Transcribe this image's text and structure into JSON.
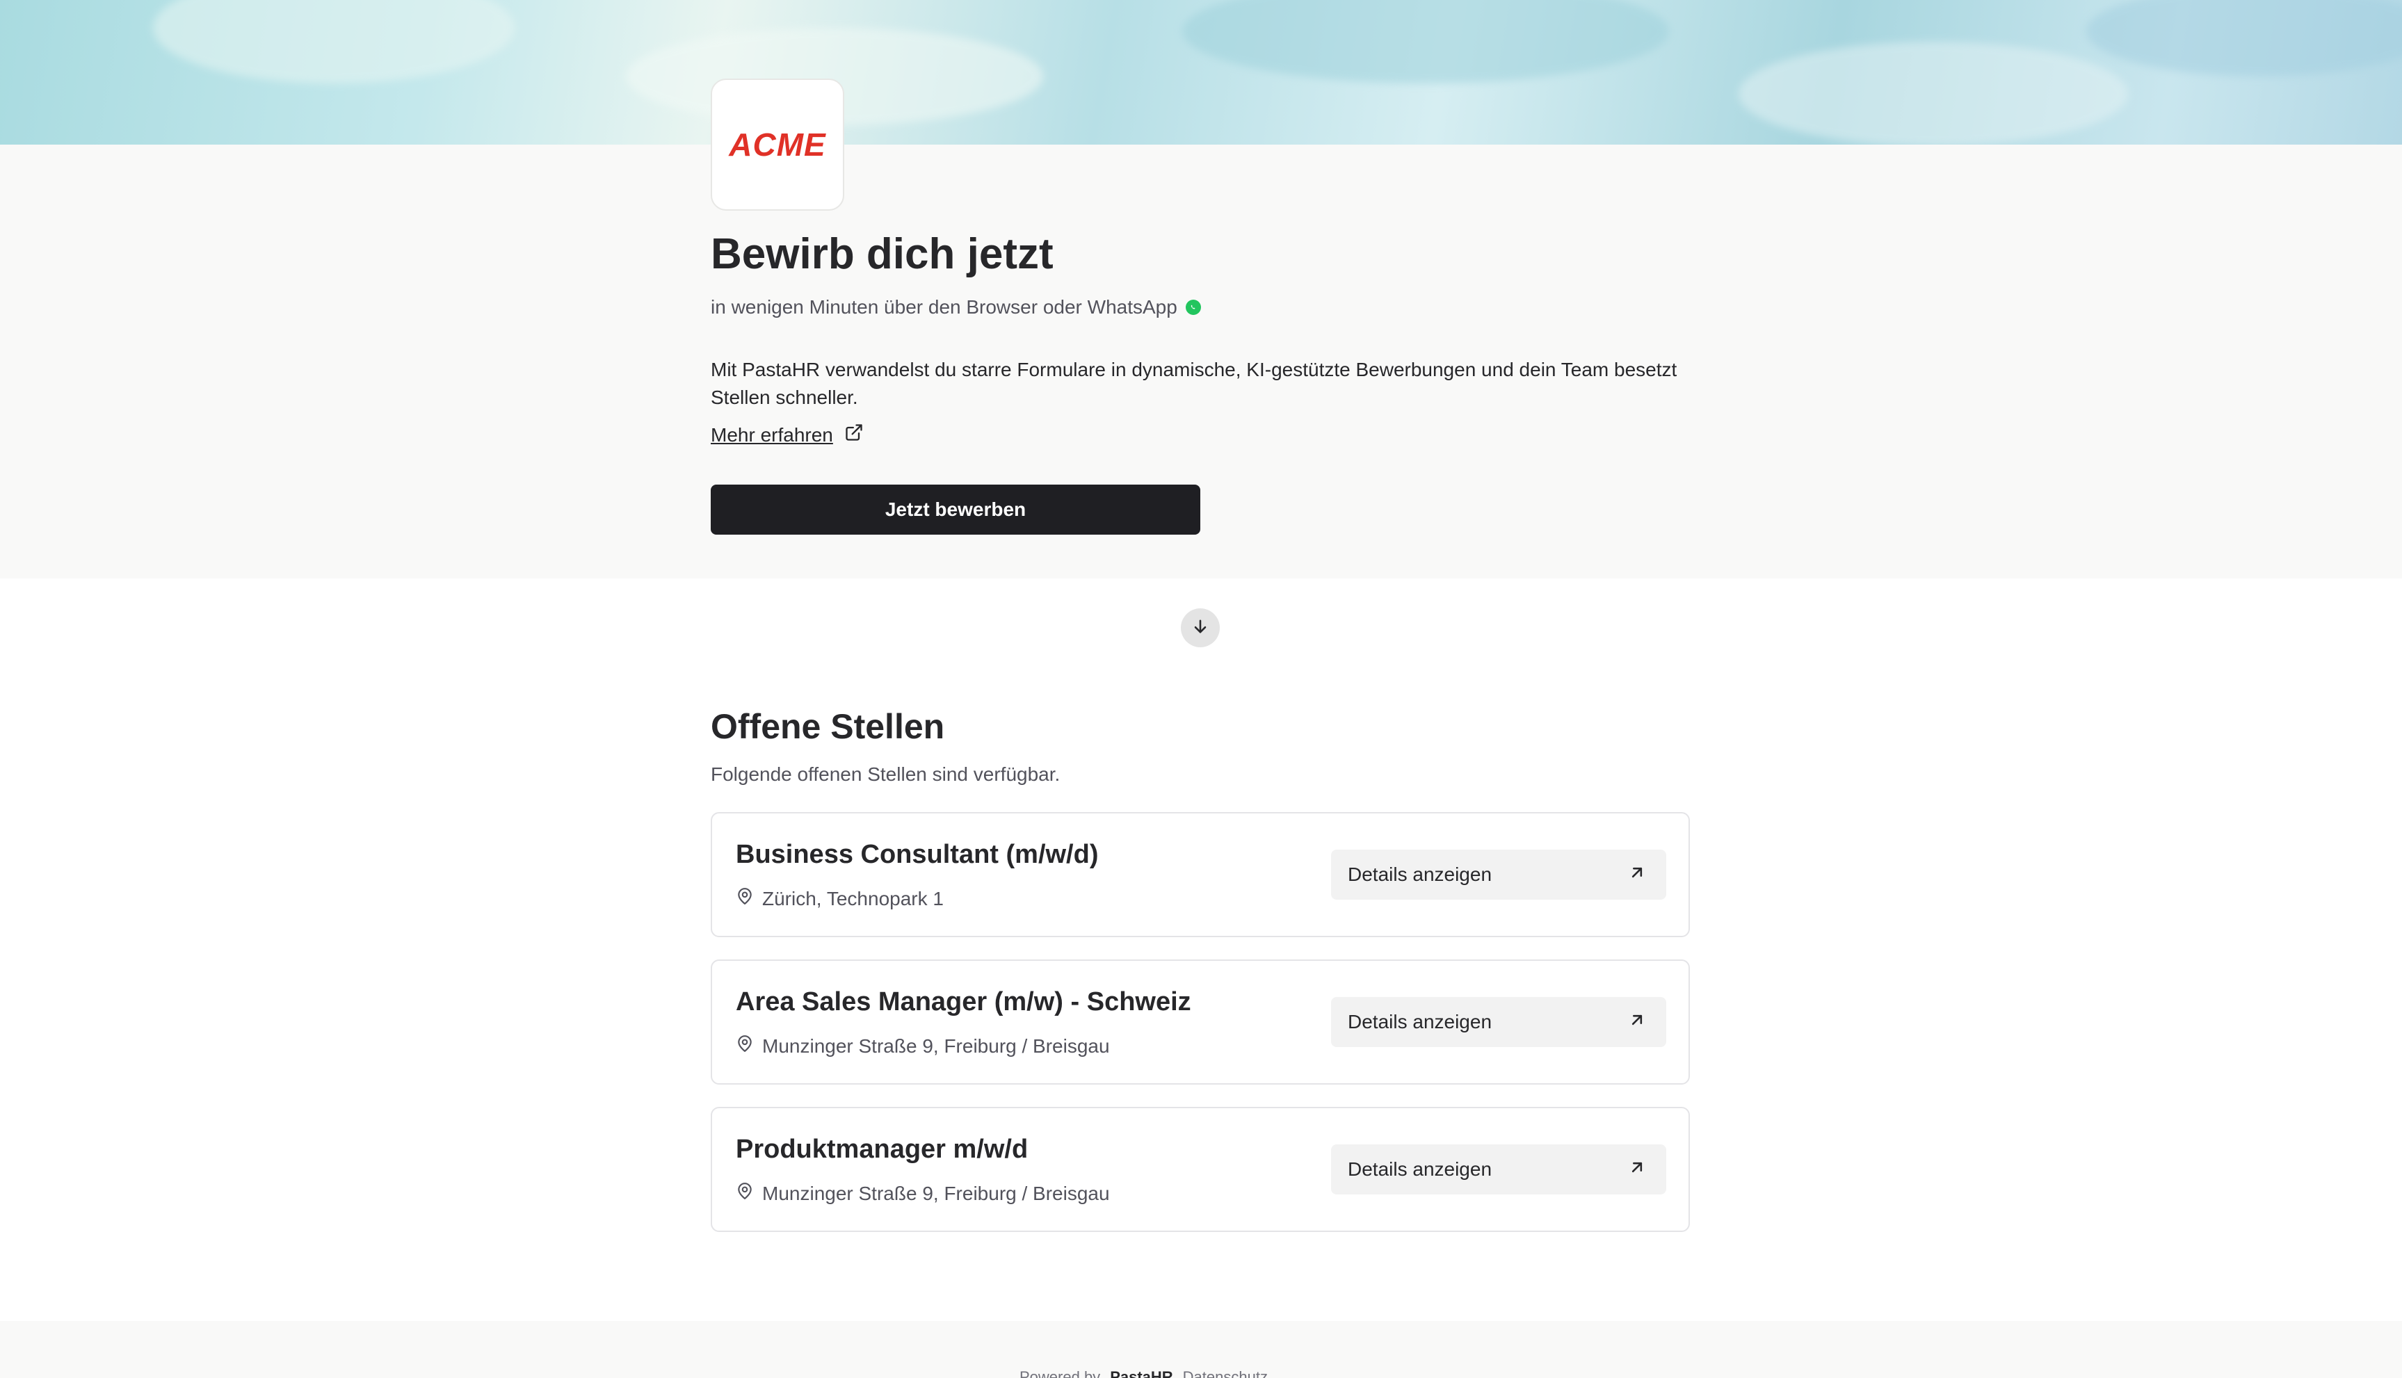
{
  "brand": {
    "logo_text": "ACME",
    "accent": "#e03127"
  },
  "hero": {
    "title": "Bewirb dich jetzt",
    "subtitle": "in wenigen Minuten über den Browser oder WhatsApp",
    "intro": "Mit PastaHR verwandelst du starre Formulare in dynamische, KI-gestützte Bewerbungen und dein Team besetzt Stellen schneller.",
    "learn_more": "Mehr erfahren",
    "apply_label": "Jetzt bewerben"
  },
  "jobs_section": {
    "title": "Offene Stellen",
    "subtitle": "Folgende offenen Stellen sind verfügbar.",
    "details_label": "Details anzeigen",
    "items": [
      {
        "title": "Business Consultant (m/w/d)",
        "location": "Zürich, Technopark 1"
      },
      {
        "title": "Area Sales Manager (m/w) - Schweiz",
        "location": "Munzinger Straße 9, Freiburg / Breisgau"
      },
      {
        "title": "Produktmanager m/w/d",
        "location": "Munzinger Straße 9, Freiburg / Breisgau"
      }
    ]
  },
  "footer": {
    "powered_by": "Powered by",
    "brand": "PastaHR",
    "privacy": "Datenschutz"
  },
  "icons": [
    "whatsapp-icon",
    "external-link-icon",
    "arrow-down-icon",
    "map-pin-icon",
    "arrow-up-right-icon"
  ]
}
